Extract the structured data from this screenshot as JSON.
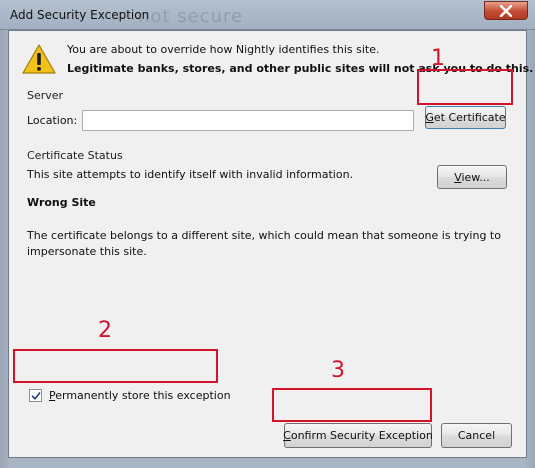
{
  "window": {
    "title": "Add Security Exception",
    "background_text": "not secure"
  },
  "warning": {
    "line1": "You are about to override how Nightly identifies this site.",
    "line2": "Legitimate banks, stores, and other public sites will not ask you to do this."
  },
  "server": {
    "section_label": "Server",
    "location_label": "Location:",
    "location_value": "",
    "get_certificate_label": "Get Certificate"
  },
  "certificate_status": {
    "section_label": "Certificate Status",
    "description": "This site attempts to identify itself with invalid information.",
    "view_label": "View...",
    "error_title": "Wrong Site",
    "error_explanation_line1": "The certificate belongs to a different site, which could mean that someone is trying to",
    "error_explanation_line2": "impersonate this site."
  },
  "options": {
    "permanent_store_label": "Permanently store this exception",
    "permanent_store_checked": true
  },
  "footer": {
    "confirm_label": "Confirm Security Exception",
    "cancel_label": "Cancel"
  },
  "annotations": {
    "step1": "1",
    "step2": "2",
    "step3": "3",
    "color": "#d1142a"
  },
  "icons": {
    "warning": "warning-triangle-icon",
    "close": "close-icon",
    "checkbox": "checkmark-icon"
  }
}
